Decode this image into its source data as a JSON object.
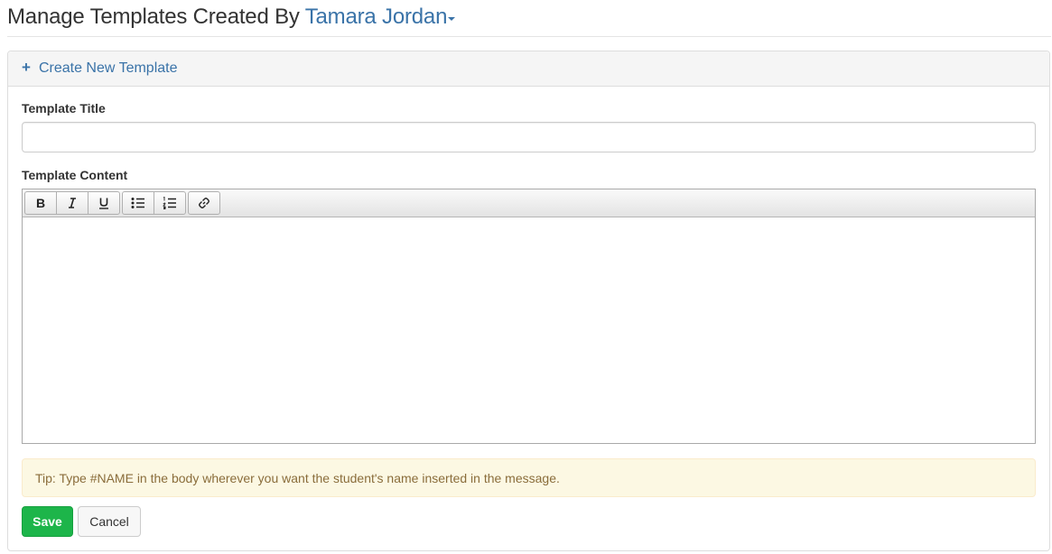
{
  "header": {
    "title_prefix": "Manage Templates Created By",
    "user_name": "Tamara Jordan"
  },
  "panel": {
    "create_label": "Create New Template",
    "create_icon": "plus-icon"
  },
  "form": {
    "title_label": "Template Title",
    "title_value": "",
    "title_placeholder": "",
    "content_label": "Template Content",
    "content_value": "",
    "toolbar": [
      "bold-icon",
      "italic-icon",
      "underline-icon",
      "bullet-list-icon",
      "numbered-list-icon",
      "link-icon"
    ],
    "tip": "Tip: Type #NAME in the body wherever you want the student's name inserted in the message.",
    "save_label": "Save",
    "cancel_label": "Cancel"
  },
  "colors": {
    "link": "#3a73a8",
    "save": "#1db54a",
    "tip_bg": "#fcf8e3",
    "tip_text": "#8a6d3b"
  }
}
